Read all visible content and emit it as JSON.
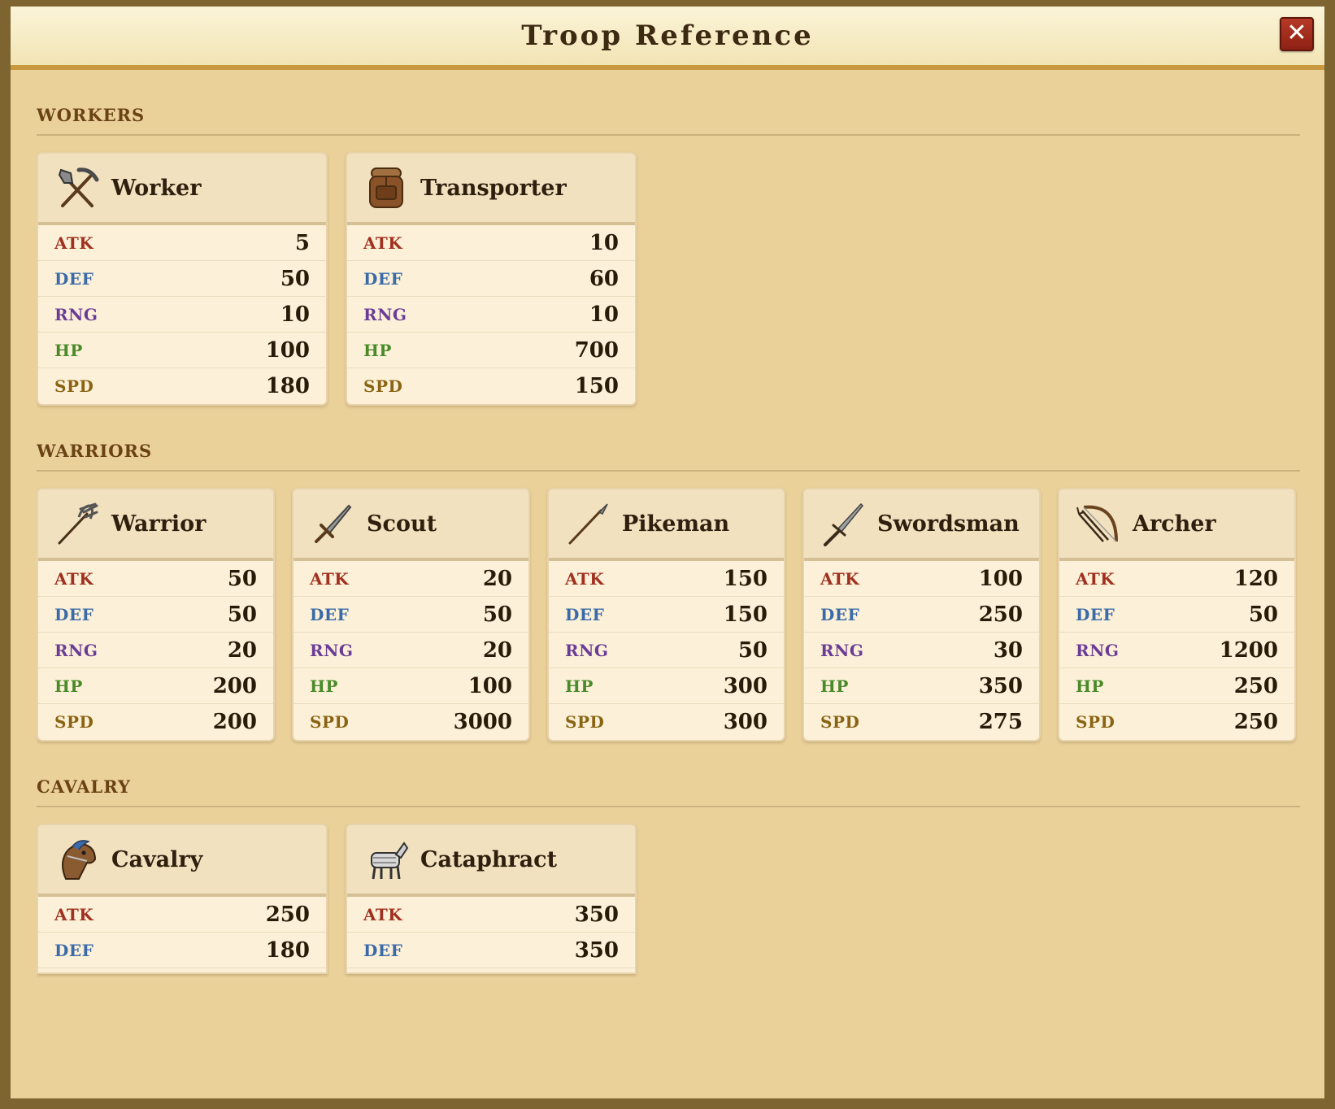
{
  "title": "Troop Reference",
  "close_label": "✕",
  "stat_labels": {
    "atk": "ATK",
    "def": "DEF",
    "rng": "RNG",
    "hp": "HP",
    "spd": "SPD"
  },
  "sections": [
    {
      "title": "WORKERS",
      "units": [
        {
          "name": "Worker",
          "icon": "pickaxe-shovel-icon",
          "atk": "5",
          "def": "50",
          "rng": "10",
          "hp": "100",
          "spd": "180"
        },
        {
          "name": "Transporter",
          "icon": "backpack-icon",
          "atk": "10",
          "def": "60",
          "rng": "10",
          "hp": "700",
          "spd": "150"
        }
      ]
    },
    {
      "title": "WARRIORS",
      "units": [
        {
          "name": "Warrior",
          "icon": "trident-icon",
          "atk": "50",
          "def": "50",
          "rng": "20",
          "hp": "200",
          "spd": "200"
        },
        {
          "name": "Scout",
          "icon": "dagger-icon",
          "atk": "20",
          "def": "50",
          "rng": "20",
          "hp": "100",
          "spd": "3000"
        },
        {
          "name": "Pikeman",
          "icon": "pike-icon",
          "atk": "150",
          "def": "150",
          "rng": "50",
          "hp": "300",
          "spd": "300"
        },
        {
          "name": "Swordsman",
          "icon": "sword-icon",
          "atk": "100",
          "def": "250",
          "rng": "30",
          "hp": "350",
          "spd": "275"
        },
        {
          "name": "Archer",
          "icon": "bow-arrows-icon",
          "atk": "120",
          "def": "50",
          "rng": "1200",
          "hp": "250",
          "spd": "250"
        }
      ]
    },
    {
      "title": "CAVALRY",
      "units": [
        {
          "name": "Cavalry",
          "icon": "horse-head-icon",
          "atk": "250",
          "def": "180"
        },
        {
          "name": "Cataphract",
          "icon": "armored-horse-icon",
          "atk": "350",
          "def": "350"
        }
      ]
    }
  ]
}
